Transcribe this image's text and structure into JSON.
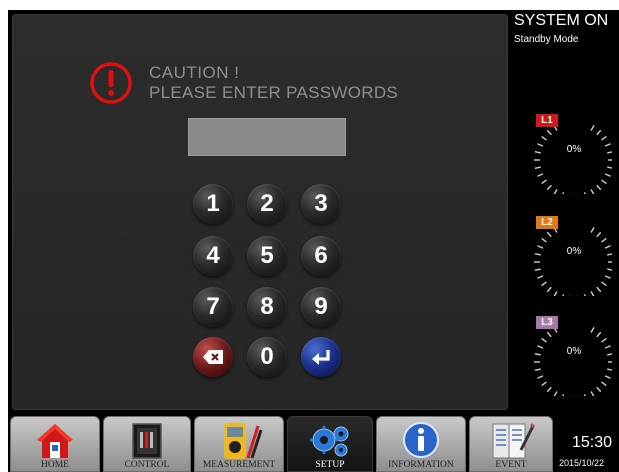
{
  "status": {
    "title": "SYSTEM ON",
    "mode": "Standby Mode"
  },
  "dialog": {
    "caution_title": "CAUTION !",
    "caution_message": "PLEASE ENTER PASSWORDS",
    "password_value": ""
  },
  "keypad": {
    "keys": [
      "1",
      "2",
      "3",
      "4",
      "5",
      "6",
      "7",
      "8",
      "9"
    ],
    "zero": "0",
    "delete_icon": "backspace-icon",
    "enter_icon": "enter-icon"
  },
  "gauges": [
    {
      "label": "L1",
      "value": "0%",
      "color": "#d01818"
    },
    {
      "label": "L2",
      "value": "0%",
      "color": "#e07818"
    },
    {
      "label": "L3",
      "value": "0%",
      "color": "#a878a8"
    }
  ],
  "nav": {
    "items": [
      {
        "label": "HOME",
        "icon": "home-icon"
      },
      {
        "label": "CONTROL",
        "icon": "control-icon"
      },
      {
        "label": "MEASUREMENT",
        "icon": "multimeter-icon"
      },
      {
        "label": "SETUP",
        "icon": "gears-icon",
        "active": true
      },
      {
        "label": "INFORMATION",
        "icon": "info-icon"
      },
      {
        "label": "EVENT",
        "icon": "event-log-icon"
      }
    ]
  },
  "clock": {
    "time": "15:30",
    "date": "2015/10/22"
  },
  "colors": {
    "caution_red": "#e01010",
    "background": "#000000",
    "panel": "#2a2a2a"
  }
}
